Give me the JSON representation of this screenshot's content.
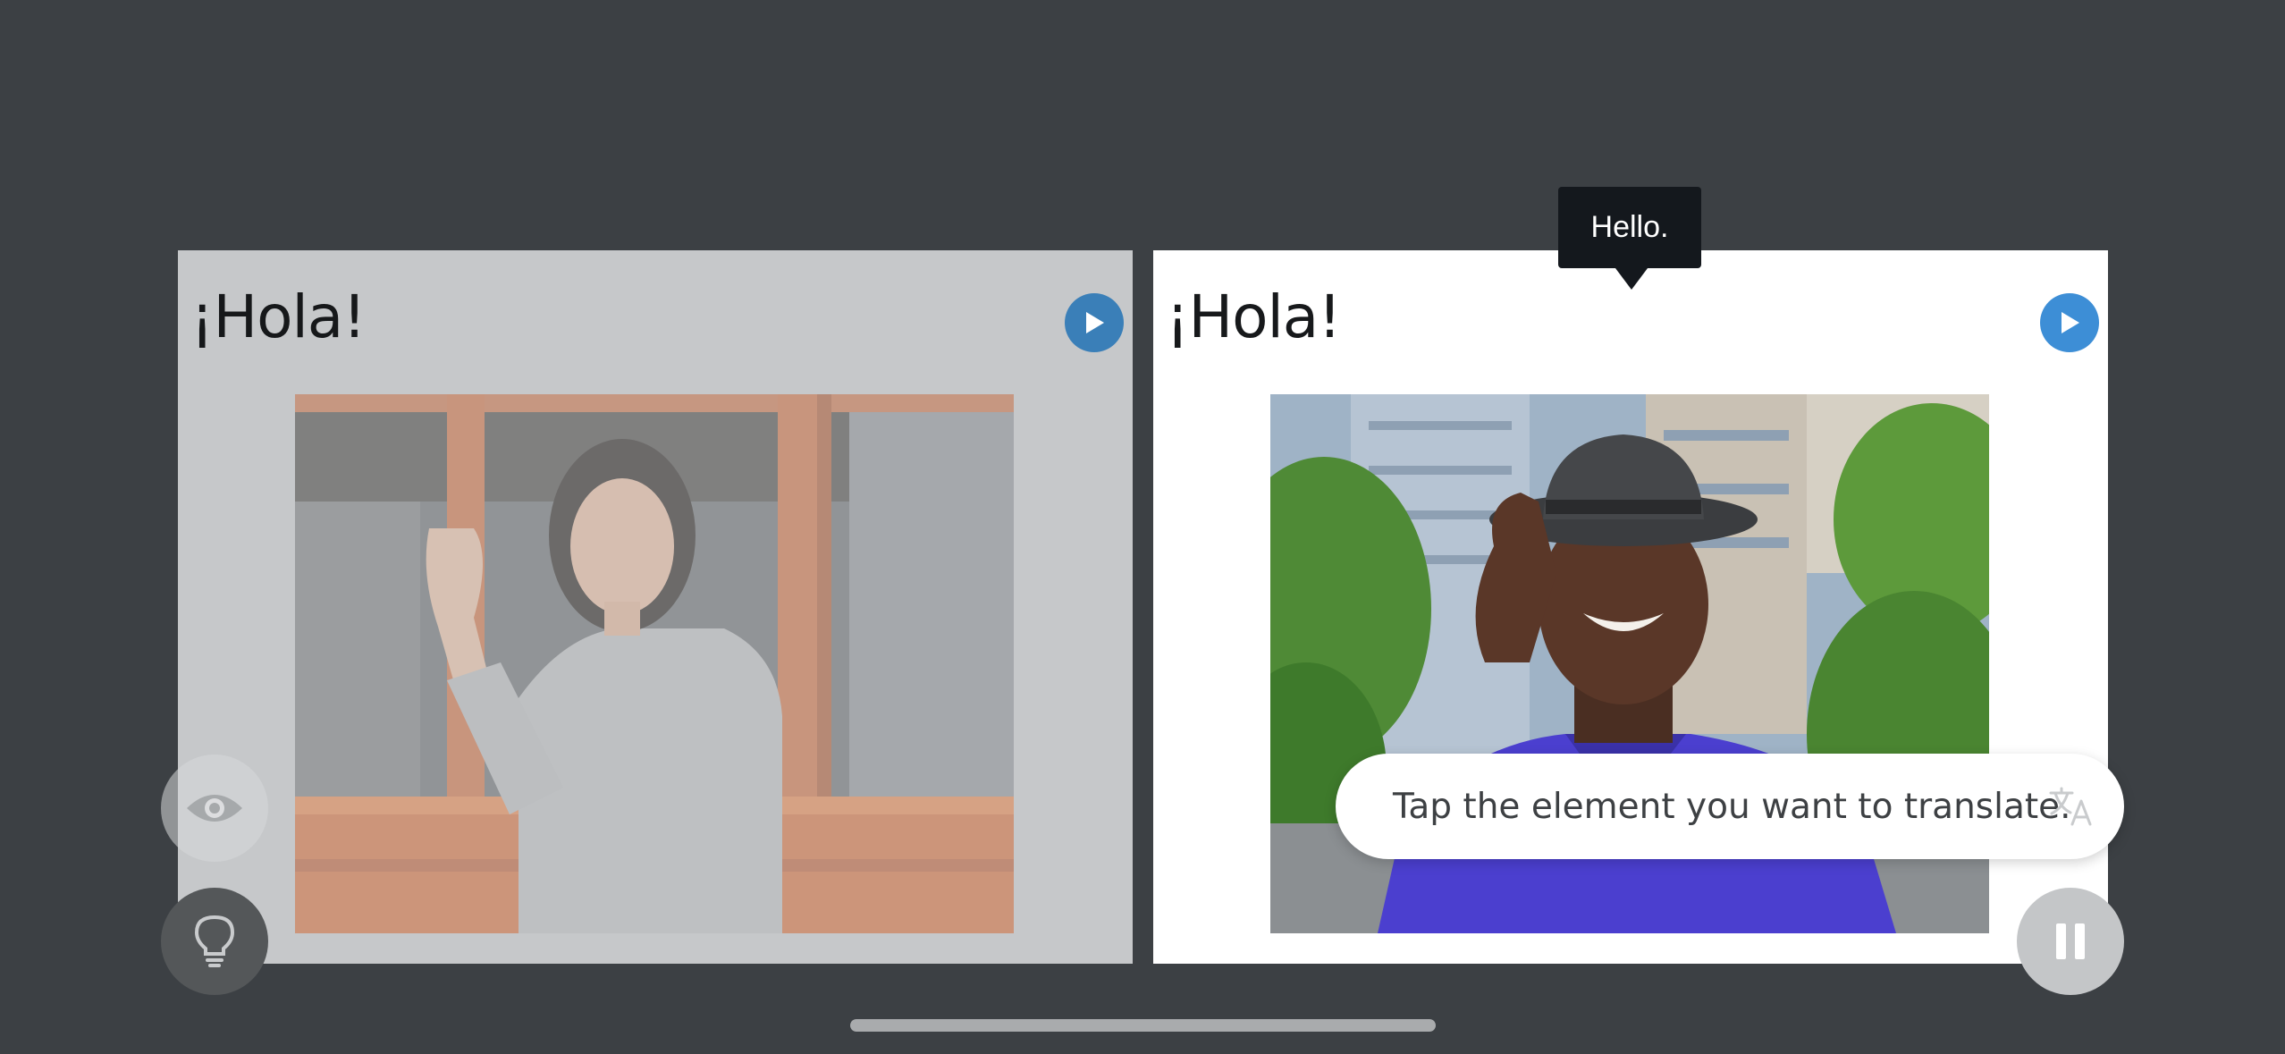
{
  "cards": [
    {
      "title": "¡Hola!",
      "play_icon": "play-icon",
      "photo_description_icon": "photo",
      "state": "dimmed"
    },
    {
      "title": "¡Hola!",
      "play_icon": "play-icon",
      "photo_description_icon": "photo",
      "state": "active"
    }
  ],
  "tooltip": {
    "text": "Hello."
  },
  "translate_hint": {
    "text": "Tap the element you want to translate.",
    "icon": "translate-icon"
  },
  "controls": {
    "eye_icon": "eye-icon",
    "hint_icon": "lightbulb-icon",
    "pause_icon": "pause-icon"
  },
  "colors": {
    "background": "#3c4044",
    "accent_blue": "#3d8ed6",
    "card_active": "#ffffff",
    "card_dimmed": "#c6c8ca",
    "tooltip_bg": "#14181d"
  }
}
